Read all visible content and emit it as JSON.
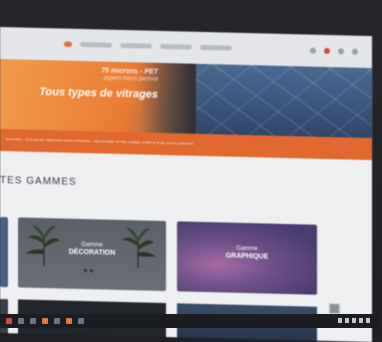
{
  "hero": {
    "line1": "75 microns - PET",
    "line2": "aspect micro perforé",
    "title": "Tous types de vitrages"
  },
  "promo": {
    "text": "NOUVEAU - FILM MICRO PERFORE POUR VITRAGES - DECOUVREZ NOTRE GAMME COMPLETE DE FILMS ADHESIFS"
  },
  "section": {
    "title": "TES GAMMES"
  },
  "cards": [
    {
      "prefix": "Gamme",
      "name": "DÉCORATION"
    },
    {
      "prefix": "Gamme",
      "name": "GRAPHIQUE"
    }
  ],
  "colors": {
    "accent": "#e1682e",
    "hero_orange": "#eb7b34",
    "hero_glass": "#2e4668",
    "page_bg": "#eeeff1"
  }
}
